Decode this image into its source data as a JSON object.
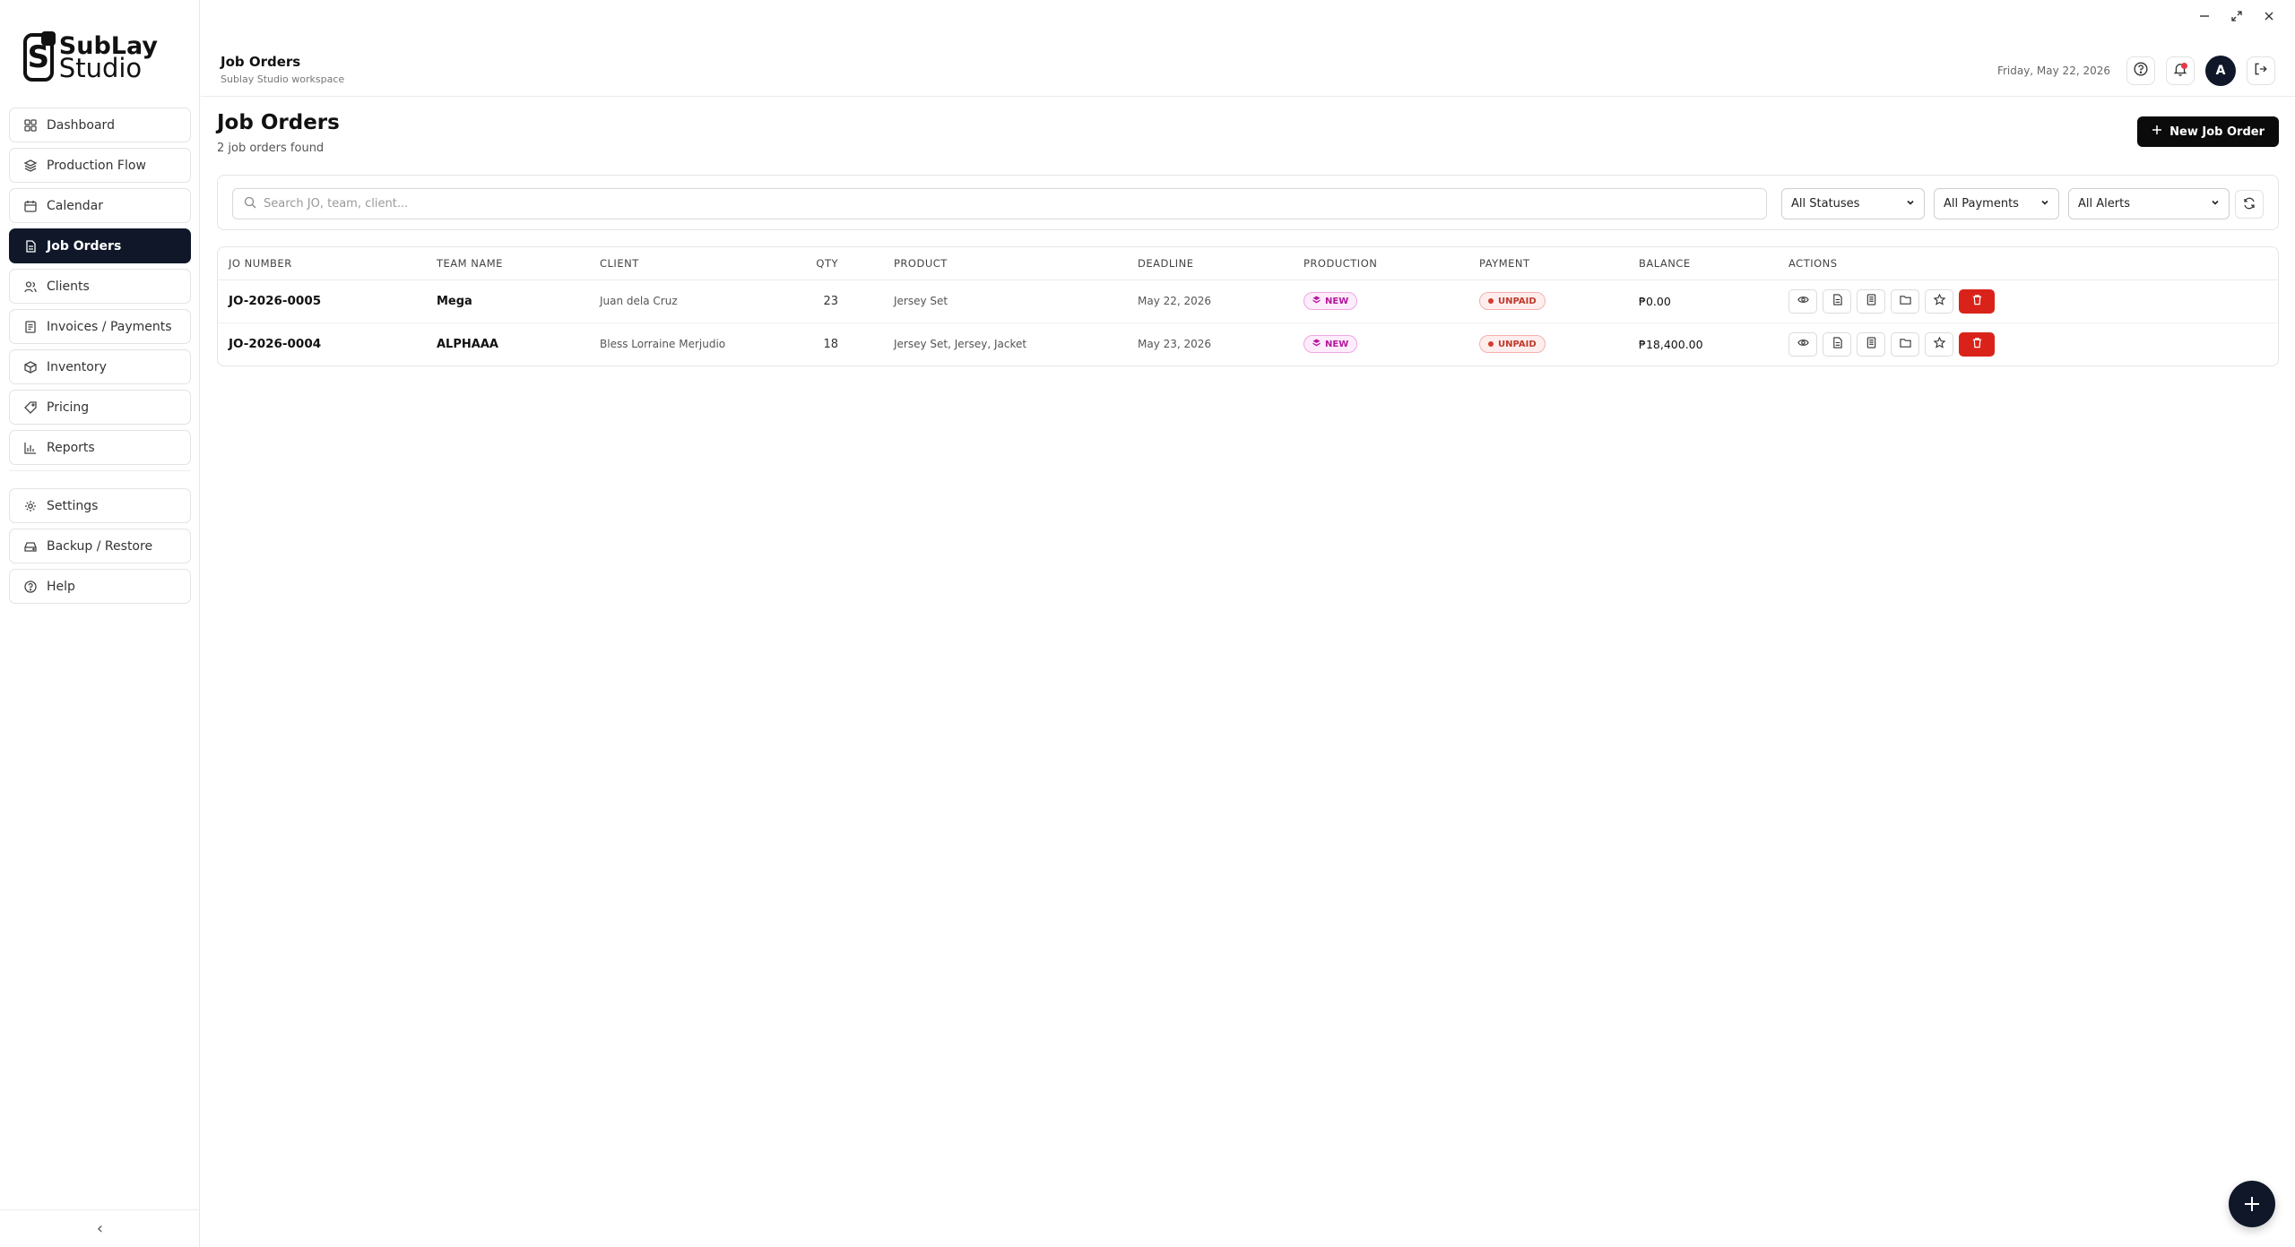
{
  "app": {
    "logo_line1": "SubLay",
    "logo_line2": "Studio"
  },
  "sidebar": {
    "items": [
      {
        "label": "Dashboard",
        "icon": "dashboard-icon"
      },
      {
        "label": "Production Flow",
        "icon": "layers-icon"
      },
      {
        "label": "Calendar",
        "icon": "calendar-icon"
      },
      {
        "label": "Job Orders",
        "icon": "document-icon",
        "active": true
      },
      {
        "label": "Clients",
        "icon": "users-icon"
      },
      {
        "label": "Invoices / Payments",
        "icon": "invoice-icon"
      },
      {
        "label": "Inventory",
        "icon": "box-icon"
      },
      {
        "label": "Pricing",
        "icon": "tag-icon"
      },
      {
        "label": "Reports",
        "icon": "bar-chart-icon"
      }
    ],
    "secondary": [
      {
        "label": "Settings",
        "icon": "gear-icon"
      },
      {
        "label": "Backup / Restore",
        "icon": "hard-drive-icon"
      },
      {
        "label": "Help",
        "icon": "help-icon"
      }
    ],
    "collapse_glyph": "‹"
  },
  "topbar": {
    "title": "Job Orders",
    "subtitle": "Sublay Studio workspace",
    "date": "Friday, May 22, 2026",
    "avatar_initial": "A"
  },
  "page": {
    "title": "Job Orders",
    "subtitle": "2 job orders found",
    "new_button": "New Job Order"
  },
  "filters": {
    "search_placeholder": "Search JO, team, client...",
    "status": "All Statuses",
    "payments": "All Payments",
    "alerts": "All Alerts"
  },
  "table": {
    "headers": [
      "JO NUMBER",
      "TEAM NAME",
      "CLIENT",
      "QTY",
      "PRODUCT",
      "DEADLINE",
      "PRODUCTION",
      "PAYMENT",
      "BALANCE",
      "ACTIONS"
    ],
    "rows": [
      {
        "jo": "JO-2026-0005",
        "team": "Mega",
        "client": "Juan dela Cruz",
        "qty": "23",
        "product": "Jersey Set",
        "deadline": "May 22, 2026",
        "production": "NEW",
        "payment": "UNPAID",
        "balance": "₱0.00"
      },
      {
        "jo": "JO-2026-0004",
        "team": "ALPHAAA",
        "client": "Bless Lorraine Merjudio",
        "qty": "18",
        "product": "Jersey Set, Jersey, Jacket",
        "deadline": "May 23, 2026",
        "production": "NEW",
        "payment": "UNPAID",
        "balance": "₱18,400.00"
      }
    ]
  },
  "colors": {
    "active_nav": "#0f1729",
    "danger": "#d9231a",
    "badge_new": "#b5179e",
    "badge_unpaid": "#c0392b"
  }
}
